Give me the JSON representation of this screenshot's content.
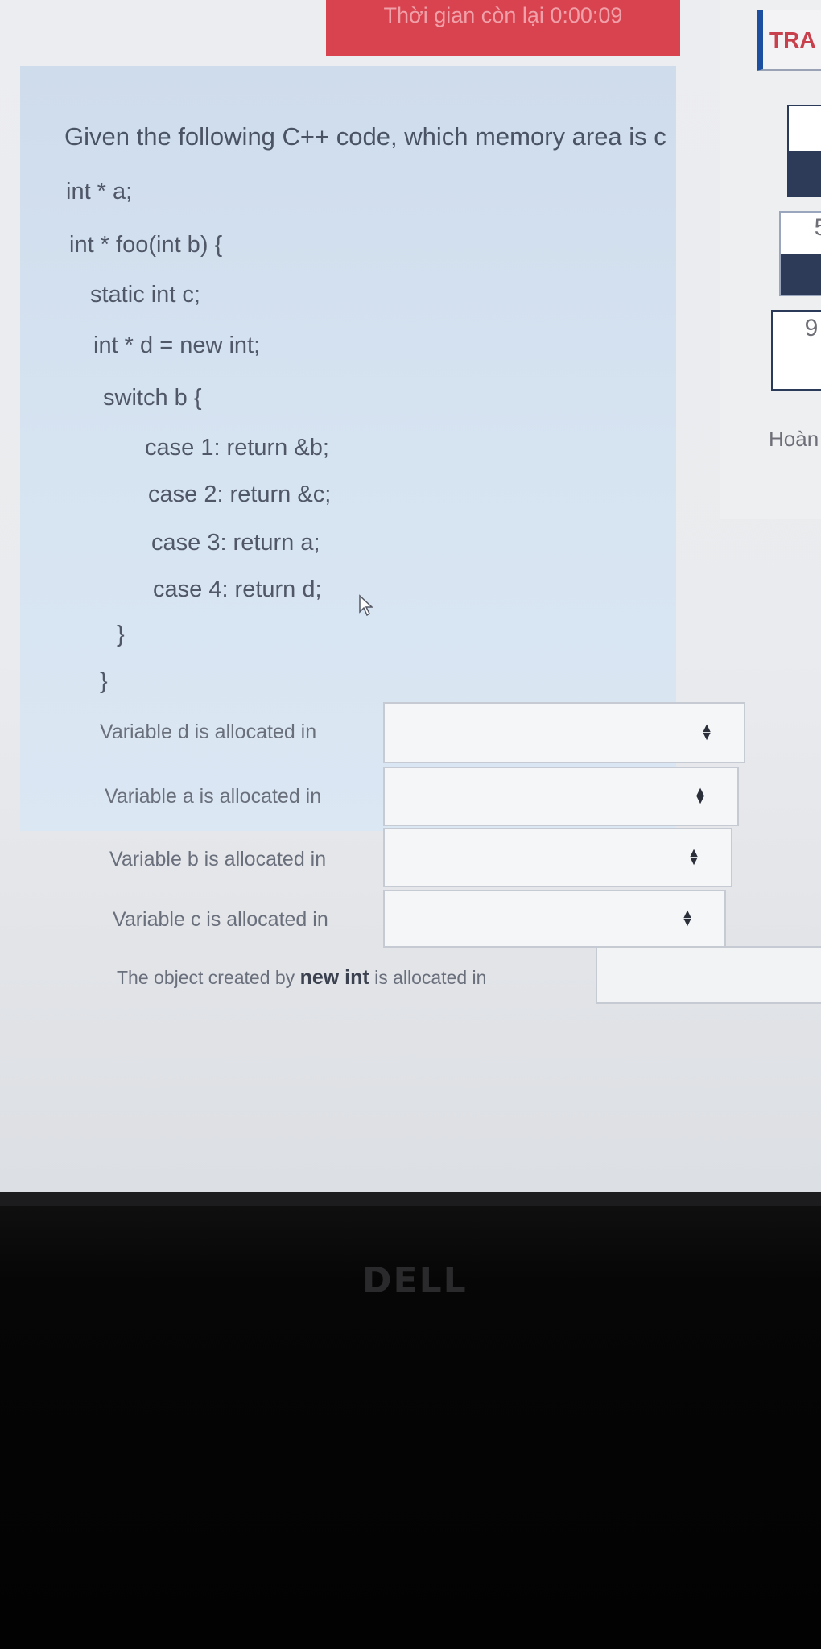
{
  "timer": {
    "label": "Thời gian còn lại 0:00:09"
  },
  "nav": {
    "tab_label": "TRA",
    "boxes": [
      "5",
      "9"
    ],
    "finish_label": "Hoàn"
  },
  "question": {
    "title": "Given the following C++ code, which memory area is c",
    "code_lines": [
      "int * a;",
      "int * foo(int b) {",
      "static int c;",
      "int * d = new int;",
      "switch b {",
      "case 1: return &b;",
      "case 2: return &c;",
      "case 3: return a;",
      "case 4: return d;",
      "}",
      "}"
    ],
    "rows": [
      {
        "label": "Variable d is allocated in",
        "value": ""
      },
      {
        "label": "Variable a is allocated in",
        "value": ""
      },
      {
        "label": "Variable b is allocated in",
        "value": ""
      },
      {
        "label": "Variable c is allocated in",
        "value": ""
      }
    ],
    "last_row": {
      "prefix": "The object created by",
      "keyword": "new int",
      "suffix": "is allocated in"
    }
  },
  "device": {
    "logo": "DELL"
  }
}
